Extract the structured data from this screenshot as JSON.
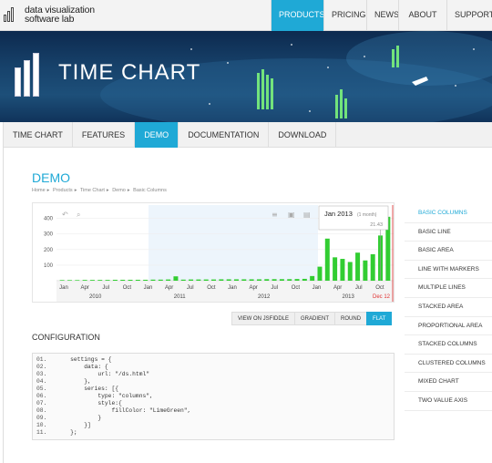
{
  "header": {
    "logo_line1": "data visualization",
    "logo_line2": "software lab",
    "nav": [
      {
        "label": "PRODUCTS",
        "active": true
      },
      {
        "label": "PRICING",
        "active": false
      },
      {
        "label": "NEWS",
        "active": false
      },
      {
        "label": "ABOUT US",
        "active": false
      },
      {
        "label": "SUPPORT",
        "active": false
      }
    ]
  },
  "hero": {
    "title": "TIME CHART"
  },
  "tabs": [
    {
      "label": "TIME CHART",
      "active": false
    },
    {
      "label": "FEATURES",
      "active": false
    },
    {
      "label": "DEMO",
      "active": true
    },
    {
      "label": "DOCUMENTATION",
      "active": false
    },
    {
      "label": "DOWNLOAD",
      "active": false
    }
  ],
  "page": {
    "title": "DEMO",
    "breadcrumb": [
      "Home",
      "Products",
      "Time Chart",
      "Demo",
      "Basic Columns"
    ]
  },
  "chart_data": {
    "type": "bar",
    "y_ticks": [
      100,
      200,
      300,
      400
    ],
    "ylim": [
      0,
      450
    ],
    "month_labels": [
      "Jan",
      "Apr",
      "Jul",
      "Oct",
      "Jan",
      "Apr",
      "Jul",
      "Oct",
      "Jan",
      "Apr",
      "Jul",
      "Oct",
      "Jan",
      "Apr",
      "Jul",
      "Oct"
    ],
    "year_labels": [
      "2010",
      "2011",
      "2012",
      "2013"
    ],
    "series": [
      {
        "values": [
          4,
          4,
          4,
          5,
          5,
          5,
          5,
          6,
          6,
          6,
          6,
          6,
          7,
          7,
          8,
          28,
          7,
          8,
          8,
          8,
          8,
          9,
          9,
          9,
          9,
          9,
          9,
          10,
          10,
          10,
          10,
          11,
          12,
          30,
          90,
          270,
          150,
          140,
          120,
          180,
          130,
          170,
          290,
          410
        ]
      }
    ],
    "bar_color": "#32cd32",
    "tooltip": {
      "title": "Jan 2013",
      "subtitle": "(1 month)",
      "value": "21.43"
    },
    "highlight_label": "Dec 12"
  },
  "buttons": [
    {
      "label": "VIEW ON JSFIDDLE",
      "active": false
    },
    {
      "label": "GRADIENT",
      "active": false
    },
    {
      "label": "ROUND",
      "active": false
    },
    {
      "label": "FLAT",
      "active": true
    }
  ],
  "config": {
    "title": "CONFIGURATION",
    "lines": [
      {
        "n": "01.",
        "code": "    settings = {"
      },
      {
        "n": "02.",
        "code": "        data: {"
      },
      {
        "n": "03.",
        "code": "            url: \"/ds.html\""
      },
      {
        "n": "04.",
        "code": "        },"
      },
      {
        "n": "05.",
        "code": "        series: [{"
      },
      {
        "n": "06.",
        "code": "            type: \"columns\","
      },
      {
        "n": "07.",
        "code": "            style:{"
      },
      {
        "n": "08.",
        "code": "                fillColor: \"LimeGreen\","
      },
      {
        "n": "09.",
        "code": "            }"
      },
      {
        "n": "10.",
        "code": "        }]"
      },
      {
        "n": "11.",
        "code": "    };"
      }
    ]
  },
  "sidebar": [
    {
      "label": "BASIC COLUMNS",
      "active": true
    },
    {
      "label": "BASIC LINE",
      "active": false
    },
    {
      "label": "BASIC AREA",
      "active": false
    },
    {
      "label": "LINE WITH MARKERS",
      "active": false
    },
    {
      "label": "MULTIPLE LINES",
      "active": false
    },
    {
      "label": "STACKED AREA",
      "active": false
    },
    {
      "label": "PROPORTIONAL AREA",
      "active": false
    },
    {
      "label": "STACKED COLUMNS",
      "active": false
    },
    {
      "label": "CLUSTERED COLUMNS",
      "active": false
    },
    {
      "label": "MIXED CHART",
      "active": false
    },
    {
      "label": "TWO VALUE AXIS",
      "active": false
    }
  ]
}
